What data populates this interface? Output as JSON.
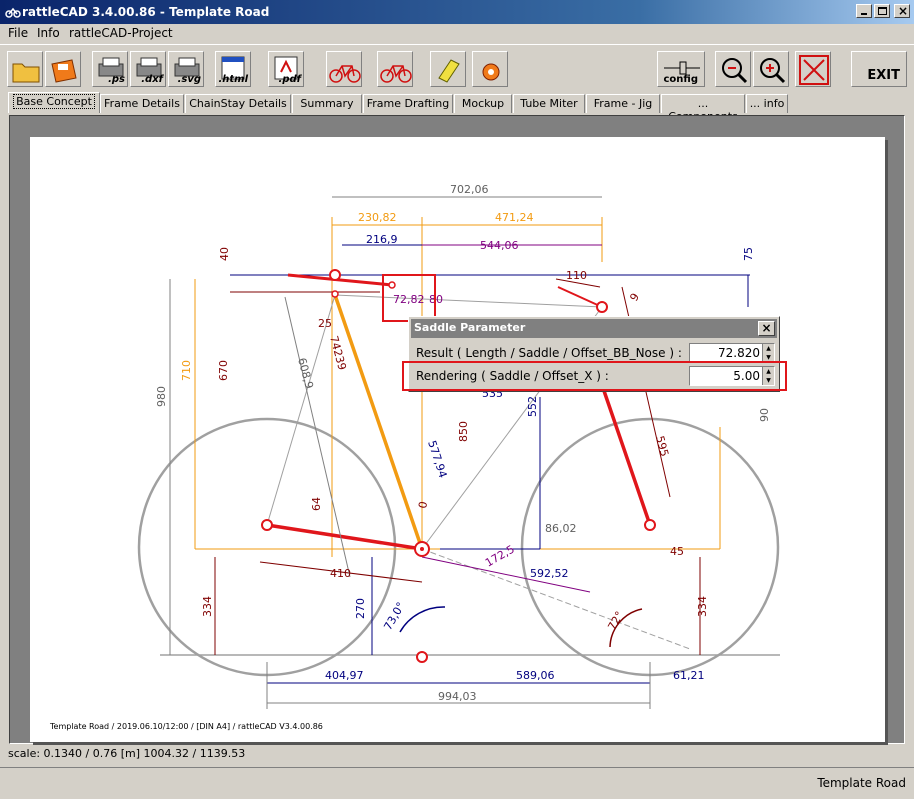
{
  "window": {
    "title": "rattleCAD  3.4.00.86 - Template Road"
  },
  "menu": [
    "File",
    "Info",
    "rattleCAD-Project"
  ],
  "toolbar": {
    "ps_label": ".ps",
    "dxf_label": ".dxf",
    "svg_label": ".svg",
    "html_label": ".html",
    "pdf_label": ".pdf",
    "config_label": "config",
    "exit_label": "EXIT"
  },
  "tabs": [
    {
      "label": "Base Concept",
      "active": true
    },
    {
      "label": "Frame Details"
    },
    {
      "label": "ChainStay Details"
    },
    {
      "label": "Summary"
    },
    {
      "label": "Frame Drafting"
    },
    {
      "label": "Mockup"
    },
    {
      "label": "Tube Miter"
    },
    {
      "label": "Frame - Jig"
    },
    {
      "label": "... Components"
    },
    {
      "label": "... info"
    }
  ],
  "drawing": {
    "dimensions": [
      "702,06",
      "230,82",
      "471,24",
      "216,9",
      "544,06",
      "75",
      "40",
      "110",
      "9",
      "72,82",
      "80",
      "25",
      "710",
      "670",
      "980",
      "74239",
      "608,9",
      "577,94",
      "850",
      "552",
      "535",
      "90",
      "0",
      "64",
      "86,02",
      "595",
      "45",
      "410",
      "172,5",
      "592,52",
      "334",
      "270",
      "73,0°",
      "72°",
      "334",
      "404,97",
      "589,06",
      "61,21",
      "994,03"
    ],
    "footer": "Template Road   /   2019.06.10/12:00   /  [DIN A4]  /   rattleCAD   V3.4.00.86"
  },
  "dialog": {
    "title": "Saddle Parameter",
    "close": "×",
    "rows": [
      {
        "label": "Result ( Length / Saddle / Offset_BB_Nose ) :",
        "value": "72.820"
      },
      {
        "label": "Rendering ( Saddle / Offset_X ) :",
        "value": "5.00"
      }
    ]
  },
  "status": {
    "scale": "scale: 0.1340 / 0.76  [m]  1004.32 / 1139.53",
    "project": "Template Road"
  },
  "colors": {
    "accent_red": "#e0161b",
    "orange": "#f29b12",
    "dim_dark": "#00007f",
    "purple": "#800080",
    "maroon": "#7f0000"
  }
}
